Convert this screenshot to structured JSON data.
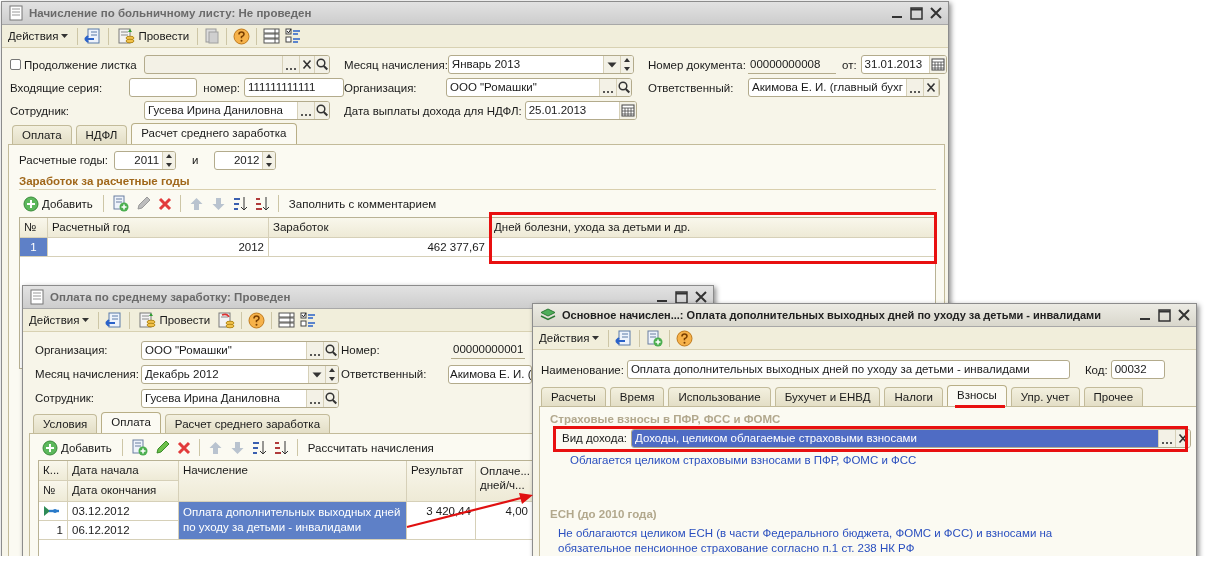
{
  "main_window": {
    "title": "Начисление по больничному листу: Не проведен",
    "active": false,
    "toolbar": {
      "actions": "Действия",
      "post": "Провести"
    },
    "continuation": {
      "label": "Продолжение листка",
      "checked": false
    },
    "series": {
      "label": "Входящие серия:"
    },
    "number": {
      "label": "номер:",
      "value": "111111111111"
    },
    "employee": {
      "label": "Сотрудник:",
      "value": "Гусева Ирина Даниловна"
    },
    "month": {
      "label": "Месяц начисления:",
      "value": "Январь 2013"
    },
    "organization": {
      "label": "Организация:",
      "value": "ООО \"Ромашки\""
    },
    "payout_date": {
      "label": "Дата выплаты дохода для НДФЛ:",
      "value": "25.01.2013"
    },
    "doc_number": {
      "label": "Номер документа:",
      "value": "00000000008"
    },
    "doc_date": {
      "label": "от:",
      "value": "31.01.2013"
    },
    "responsible": {
      "label": "Ответственный:",
      "value": "Акимова Е. И. (главный бухг"
    },
    "tabs": [
      {
        "label": "Оплата",
        "selected": false
      },
      {
        "label": "НДФЛ",
        "selected": false
      },
      {
        "label": "Расчет среднего заработка",
        "selected": true
      }
    ],
    "years": {
      "label": "Расчетные годы:",
      "from": "2011",
      "joiner": "и",
      "to": "2012"
    },
    "section_title": "Заработок за расчетные годы",
    "table_toolbar": {
      "add": "Добавить",
      "command": "Заполнить с комментарием"
    },
    "table": {
      "columns": [
        "№",
        "Расчетный год",
        "Заработок",
        "Дней болезни, ухода за детьми и др."
      ],
      "rows": [
        {
          "selected": true,
          "cells": [
            "1",
            "2012",
            "462 377,67"
          ]
        }
      ]
    }
  },
  "payment_window": {
    "title": "Оплата по среднему заработку: Проведен",
    "active": false,
    "toolbar": {
      "actions": "Действия",
      "post": "Провести"
    },
    "organization": {
      "label": "Организация:",
      "value": "ООО \"Ромашки\""
    },
    "month": {
      "label": "Месяц начисления:",
      "value": "Декабрь 2012"
    },
    "employee": {
      "label": "Сотрудник:",
      "value": "Гусева Ирина Даниловна"
    },
    "doc_number": {
      "label": "Номер:",
      "value": "00000000001"
    },
    "responsible": {
      "label": "Ответственный:",
      "value": "Акимова Е. И. ("
    },
    "tabs": [
      {
        "label": "Условия",
        "selected": false
      },
      {
        "label": "Оплата",
        "selected": true
      },
      {
        "label": "Расчет среднего заработка",
        "selected": false
      }
    ],
    "table_toolbar": {
      "add": "Добавить",
      "command": "Рассчитать начисления"
    },
    "table": {
      "columns": [
        {
          "text": "К...",
          "sub": "№"
        },
        {
          "text": "Дата начала",
          "sub": "Дата окончания"
        },
        {
          "text": "Начисление"
        },
        {
          "text": "Результат"
        },
        {
          "text": "Оплаче... дней/ч..."
        }
      ],
      "rows": [
        {
          "selected": true,
          "number": "1",
          "start_date": "03.12.2012",
          "end_date": "06.12.2012",
          "accrual": "Оплата дополнительных выходных дней по уходу за детьми - инвалидами",
          "result": "3 420,44",
          "paid_days": "4,00"
        }
      ]
    }
  },
  "accrual_window": {
    "title": "Основное начислен...: Оплата дополнительных выходных дней по уходу за детьми - инвалидами",
    "active": true,
    "toolbar": {
      "actions": "Действия"
    },
    "name": {
      "label": "Наименование:",
      "value": "Оплата дополнительных выходных дней по уходу за детьми - инвалидами"
    },
    "code": {
      "label": "Код:",
      "value": "00032"
    },
    "tabs": [
      {
        "label": "Расчеты",
        "selected": false
      },
      {
        "label": "Время",
        "selected": false
      },
      {
        "label": "Использование",
        "selected": false
      },
      {
        "label": "Бухучет и ЕНВД",
        "selected": false
      },
      {
        "label": "Налоги",
        "selected": false
      },
      {
        "label": "Взносы",
        "selected": true
      },
      {
        "label": "Упр. учет",
        "selected": false
      },
      {
        "label": "Прочее",
        "selected": false
      }
    ],
    "contributions_title": "Страховые взносы в ПФР, ФСС и ФОМС",
    "income_type": {
      "label": "Вид дохода:",
      "value": "Доходы, целиком облагаемые страховыми взносами",
      "selected": true
    },
    "income_note": "Облагается целиком страховыми взносами в ПФР, ФОМС и ФСС",
    "esn_title": "ЕСН (до 2010 года)",
    "esn_note": "Не облагаются целиком ЕСН (в части Федерального бюджета, ФОМС и ФСС) и взносами на обязательное пенсионное страхование согласно п.1 ст. 238 НК РФ"
  }
}
